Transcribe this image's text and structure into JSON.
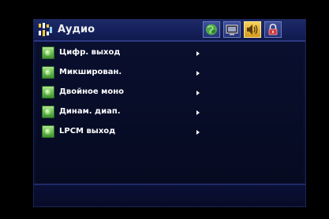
{
  "header": {
    "title": "Аудио",
    "icon": "audio-settings-icon",
    "tabs": [
      {
        "name": "language-tab",
        "icon": "globe-icon",
        "active": false
      },
      {
        "name": "video-tab",
        "icon": "display-icon",
        "active": false
      },
      {
        "name": "audio-tab",
        "icon": "speaker-icon",
        "active": true
      },
      {
        "name": "parental-tab",
        "icon": "lock-icon",
        "active": false
      }
    ]
  },
  "menu": {
    "items": [
      {
        "label": "Цифр. выход"
      },
      {
        "label": "Микширован."
      },
      {
        "label": "Двойное моно"
      },
      {
        "label": "Динам. диап."
      },
      {
        "label": "LPCM выход"
      }
    ]
  },
  "colors": {
    "background": "#000000",
    "panel": "#0a1030",
    "header": "#15205a",
    "active_tab": "#e6b53a",
    "bullet": "#74c65a",
    "text": "#ffffff"
  }
}
